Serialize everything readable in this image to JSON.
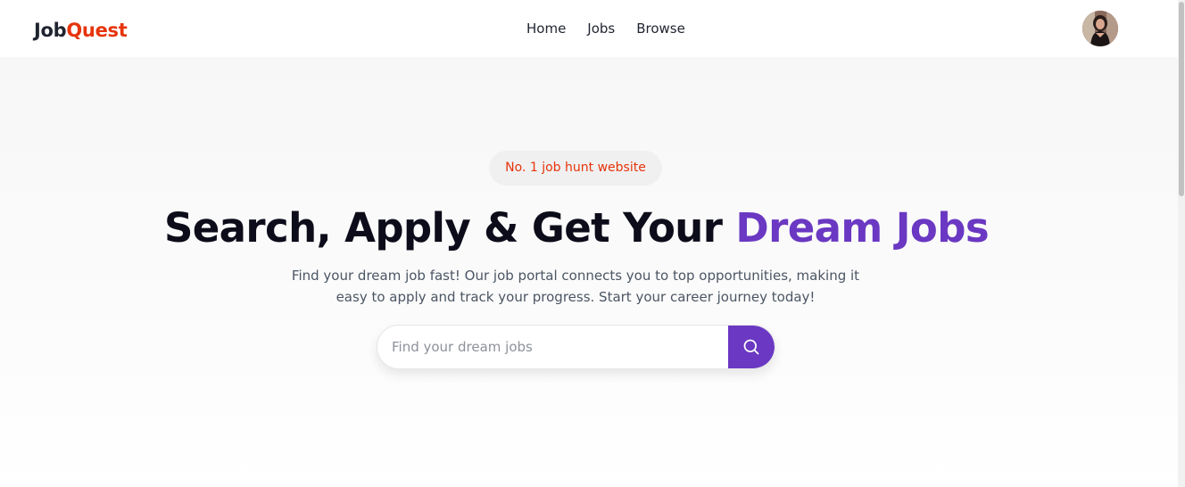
{
  "brand": {
    "part1": "Job",
    "part2": "Quest",
    "color1": "#1f2430",
    "color2": "#e6340b"
  },
  "nav": {
    "items": [
      "Home",
      "Jobs",
      "Browse"
    ]
  },
  "user": {
    "avatar_icon": "user-avatar"
  },
  "hero": {
    "badge": "No. 1 job hunt website",
    "headline_main": "Search, Apply & Get Your ",
    "headline_accent": "Dream Jobs",
    "subtitle": "Find your dream job fast! Our job portal connects you to top opportunities, making it easy to apply and track your progress. Start your career journey today!",
    "search": {
      "placeholder": "Find your dream jobs",
      "value": "",
      "button_icon": "search-icon"
    }
  },
  "colors": {
    "accent": "#6a38c2",
    "brand_red": "#e6340b",
    "heading": "#0c0c1a"
  }
}
